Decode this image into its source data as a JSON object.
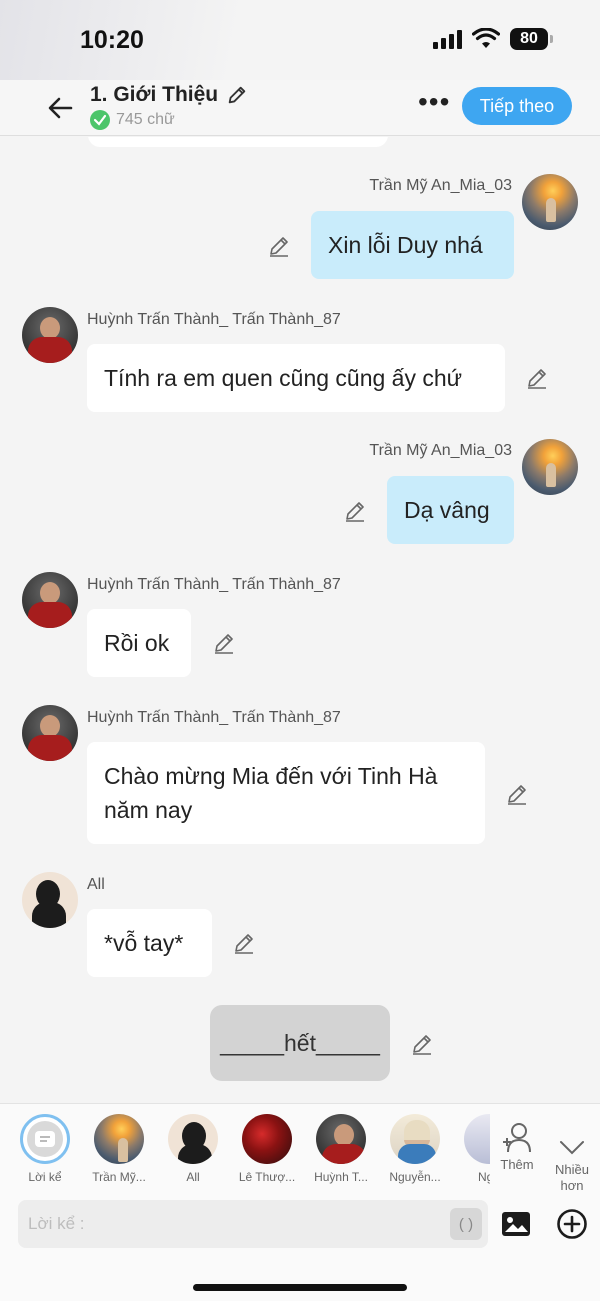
{
  "status": {
    "time": "10:20",
    "battery": "80"
  },
  "header": {
    "title": "1. Giới Thiệu",
    "word_count": "745 chữ",
    "more": "•••",
    "next_button": "Tiếp theo"
  },
  "messages": [
    {
      "sender": "Trần Mỹ An_Mia_03",
      "text": "Xin lỗi Duy nhá",
      "side": "right",
      "avatar": "sunset-girl-avatar"
    },
    {
      "sender": "Huỳnh Trấn Thành_ Trấn Thành_87",
      "text": "Tính ra em quen cũng cũng ấy chứ",
      "side": "left",
      "avatar": "man-red-hoodie-avatar"
    },
    {
      "sender": "Trần Mỹ An_Mia_03",
      "text": "Dạ vâng",
      "side": "right",
      "avatar": "sunset-girl-avatar"
    },
    {
      "sender": "Huỳnh Trấn Thành_ Trấn Thành_87",
      "text": "Rồi ok",
      "side": "left",
      "avatar": "man-red-hoodie-avatar"
    },
    {
      "sender": "Huỳnh Trấn Thành_ Trấn Thành_87",
      "text_line1": "Chào mừng Mia đến với Tinh Hà",
      "text_line2": "năm nay",
      "side": "left",
      "avatar": "man-red-hoodie-avatar"
    },
    {
      "sender": "All",
      "text": "*vỗ tay*",
      "side": "left",
      "avatar": "silhouette-avatar"
    },
    {
      "text": "_____hết_____",
      "side": "center"
    }
  ],
  "characters": [
    {
      "label": "Lời kể",
      "avatar": "narrator-icon"
    },
    {
      "label": "Trần Mỹ...",
      "avatar": "sunset-girl-avatar"
    },
    {
      "label": "All",
      "avatar": "silhouette-avatar"
    },
    {
      "label": "Lê Thượ...",
      "avatar": "roses-avatar"
    },
    {
      "label": "Huỳnh T...",
      "avatar": "man-red-hoodie-avatar"
    },
    {
      "label": "Nguyễn...",
      "avatar": "blond-man-avatar"
    },
    {
      "label": "Ngu",
      "avatar": "partial-avatar"
    }
  ],
  "side_buttons": {
    "add": "Thêm",
    "more": "Nhiều\nhơn"
  },
  "composer": {
    "placeholder": "Lời kể :",
    "paren": "( )"
  },
  "colors": {
    "accent": "#3ea6f1",
    "bubble_right": "#c9ecfb",
    "bubble_left": "#ffffff",
    "system_bubble": "#d3d3d3",
    "check": "#4cc56a"
  }
}
